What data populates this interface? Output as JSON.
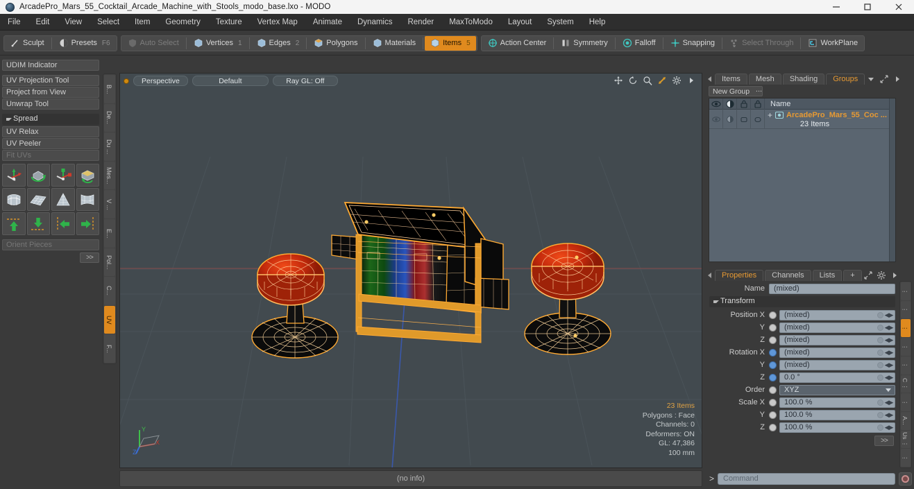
{
  "window": {
    "title": "ArcadePro_Mars_55_Cocktail_Arcade_Machine_with_Stools_modo_base.lxo - MODO",
    "minimize": "—",
    "maximize": "❐",
    "close": "✕"
  },
  "menu": [
    "File",
    "Edit",
    "View",
    "Select",
    "Item",
    "Geometry",
    "Texture",
    "Vertex Map",
    "Animate",
    "Dynamics",
    "Render",
    "MaxToModo",
    "Layout",
    "System",
    "Help"
  ],
  "toolbar": {
    "group1": [
      {
        "label": "Sculpt",
        "icon": "brush-icon",
        "state": "normal",
        "num": ""
      },
      {
        "label": "Presets",
        "icon": "sphere-icon",
        "state": "normal",
        "num": "F6"
      }
    ],
    "group2": [
      {
        "label": "Auto Select",
        "icon": "shield-icon",
        "state": "dim",
        "num": ""
      },
      {
        "label": "Vertices",
        "icon": "cube-icon",
        "state": "normal",
        "num": "1"
      },
      {
        "label": "Edges",
        "icon": "cube-icon",
        "state": "normal",
        "num": "2"
      },
      {
        "label": "Polygons",
        "icon": "cube-icon",
        "state": "normal",
        "num": ""
      },
      {
        "label": "Materials",
        "icon": "cube-icon",
        "state": "normal",
        "num": ""
      },
      {
        "label": "Items",
        "icon": "cube-icon",
        "state": "active",
        "num": "5"
      }
    ],
    "group3": [
      {
        "label": "Action Center",
        "icon": "target-icon",
        "state": "normal",
        "num": ""
      },
      {
        "label": "Symmetry",
        "icon": "mirror-icon",
        "state": "normal",
        "num": ""
      },
      {
        "label": "Falloff",
        "icon": "falloff-icon",
        "state": "normal",
        "num": ""
      },
      {
        "label": "Snapping",
        "icon": "snap-icon",
        "state": "normal",
        "num": ""
      },
      {
        "label": "Select Through",
        "icon": "select-through-icon",
        "state": "dim",
        "num": ""
      },
      {
        "label": "WorkPlane",
        "icon": "workplane-icon",
        "state": "normal",
        "num": ""
      }
    ]
  },
  "left_panel": {
    "buttons_top": [
      "UDIM Indicator"
    ],
    "buttons_mid": [
      "UV Projection Tool",
      "Project from View",
      "Unwrap Tool"
    ],
    "section": "Spread",
    "buttons_spread": [
      {
        "label": "UV Relax",
        "dim": false
      },
      {
        "label": "UV Peeler",
        "dim": false
      },
      {
        "label": "Fit UVs",
        "dim": true
      }
    ],
    "icon_row1": [
      "move-uv-icon",
      "rotate-uv-icon",
      "scale-uv-icon",
      "flip-uv-icon"
    ],
    "icon_row2": [
      "uv-fit-icon",
      "uv-grid-icon",
      "uv-cone-icon",
      "uv-distort-icon"
    ],
    "icon_row3": [
      "align-up-icon",
      "align-down-icon",
      "align-left-icon",
      "align-right-icon"
    ],
    "orient_field": "Orient Pieces",
    "more_button": ">>"
  },
  "left_vtabs": [
    {
      "label": "B...",
      "active": false
    },
    {
      "label": "De...",
      "active": false
    },
    {
      "label": "Du ...",
      "active": false
    },
    {
      "label": "Mes...",
      "active": false
    },
    {
      "label": "V ...",
      "active": false
    },
    {
      "label": "E...",
      "active": false
    },
    {
      "label": "Pol...",
      "active": false
    },
    {
      "label": "C...",
      "active": false
    },
    {
      "label": "UV",
      "active": true
    },
    {
      "label": "F...",
      "active": false
    }
  ],
  "viewport": {
    "mode": "Perspective",
    "shading": "Default",
    "raygl": "Ray GL: Off",
    "icons": [
      "move-icon",
      "rotate-icon",
      "zoom-icon",
      "fit-icon",
      "gear-icon",
      "chevron-right-icon"
    ],
    "stats": {
      "items": "23 Items",
      "polygons": "Polygons : Face",
      "channels": "Channels: 0",
      "deformers": "Deformers: ON",
      "gl": "GL: 47,386",
      "scale": "100 mm"
    },
    "axis": {
      "x": "X",
      "y": "Y",
      "z": "Z"
    }
  },
  "right_top": {
    "tabs": [
      {
        "label": "Items",
        "active": false
      },
      {
        "label": "Mesh ...",
        "active": false
      },
      {
        "label": "Shading",
        "active": false
      },
      {
        "label": "Groups",
        "active": true
      }
    ],
    "tab_icons": [
      "chevron-down-icon",
      "expand-icon",
      "chevron-right-icon"
    ],
    "new_group_button": "New Group",
    "list_header_icons": [
      "eye-icon",
      "render-icon",
      "lock-icon",
      "cube-outline-icon"
    ],
    "name_column": "Name",
    "rows": [
      {
        "name": "ArcadePro_Mars_55_Coc ...",
        "sub": "23 Items",
        "expand": "+",
        "icon": "group-icon"
      }
    ]
  },
  "right_bottom": {
    "tabs": [
      {
        "label": "Properties",
        "active": true
      },
      {
        "label": "Channels",
        "active": false
      },
      {
        "label": "Lists",
        "active": false
      },
      {
        "label": "+",
        "active": false
      }
    ],
    "tab_icons": [
      "expand-icon",
      "gear-icon",
      "chevron-right-icon"
    ],
    "name_label": "Name",
    "name_value": "(mixed)",
    "section": "Transform",
    "fields": [
      {
        "label": "Position X",
        "value": "(mixed)",
        "radio": "gray",
        "type": "num"
      },
      {
        "label": "Y",
        "value": "(mixed)",
        "radio": "gray",
        "type": "num"
      },
      {
        "label": "Z",
        "value": "(mixed)",
        "radio": "gray",
        "type": "num"
      },
      {
        "label": "Rotation X",
        "value": "(mixed)",
        "radio": "blue",
        "type": "num"
      },
      {
        "label": "Y",
        "value": "(mixed)",
        "radio": "blue",
        "type": "num"
      },
      {
        "label": "Z",
        "value": "0.0 °",
        "radio": "blue",
        "type": "num"
      },
      {
        "label": "Order",
        "value": "XYZ",
        "radio": "gray",
        "type": "dropdown"
      },
      {
        "label": "Scale X",
        "value": "100.0 %",
        "radio": "gray",
        "type": "num"
      },
      {
        "label": "Y",
        "value": "100.0 %",
        "radio": "gray",
        "type": "num"
      },
      {
        "label": "Z",
        "value": "100.0 %",
        "radio": "gray",
        "type": "num"
      }
    ],
    "more_button": ">>"
  },
  "right_vtabs": [
    {
      "label": "⋮",
      "active": false
    },
    {
      "label": "⋮",
      "active": false
    },
    {
      "label": "⋮",
      "active": true
    },
    {
      "label": "⋮",
      "active": false
    },
    {
      "label": "⋮",
      "active": false
    },
    {
      "label": "C ⋮",
      "active": false
    },
    {
      "label": "⋮",
      "active": false
    },
    {
      "label": "A...",
      "active": false
    },
    {
      "label": "Us ⋮",
      "active": false
    },
    {
      "label": "⋮",
      "active": false
    }
  ],
  "status": {
    "text": "(no info)"
  },
  "command": {
    "arrow": ">",
    "placeholder": "Command",
    "record_icon": "record-icon"
  },
  "colors": {
    "accent": "#e08a1e",
    "wireframe": "#ffaa33",
    "viewport_bg": "#424a4f",
    "panel_bg": "#3a3a3a"
  }
}
